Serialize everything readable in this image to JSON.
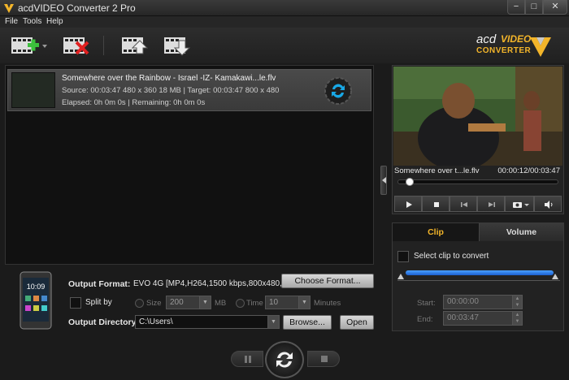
{
  "window": {
    "title": "acdVIDEO Converter 2 Pro",
    "controls": {
      "minimize": "−",
      "maximize": "□",
      "close": "✕"
    }
  },
  "menu": {
    "items": [
      "File",
      "Tools",
      "Help"
    ]
  },
  "toolbar": {
    "buttons": [
      {
        "icon": "add-video-icon"
      },
      {
        "icon": "remove-video-icon"
      },
      {
        "icon": "move-up-icon"
      },
      {
        "icon": "move-down-icon"
      }
    ]
  },
  "logo": {
    "acd": "acd",
    "video": "VIDEO",
    "converter": "CONVERTER"
  },
  "file_list": {
    "items": [
      {
        "name": "Somewhere over the Rainbow - Israel -IZ- Kamakawi...le.flv",
        "info": "Source: 00:03:47 480 x 360 18 MB | Target: 00:03:47 800 x 480",
        "time": "Elapsed: 0h 0m 0s | Remaining: 0h 0m 0s"
      }
    ]
  },
  "output": {
    "format_label": "Output Format:",
    "format_value": "EVO 4G [MP4,H264,1500 kbps,800x480,...",
    "choose_format": "Choose Format...",
    "split_label": "Split by",
    "size_label": "Size",
    "size_value": "200",
    "size_unit": "MB",
    "time_label": "Time",
    "time_value": "10",
    "time_unit": "Minutes",
    "directory_label": "Output Directory:",
    "directory_value": "C:\\Users\\",
    "browse": "Browse...",
    "open": "Open"
  },
  "preview": {
    "file_name": "Somewhere over t...le.flv",
    "time": "00:00:12/00:03:47",
    "seek_fraction": 0.05
  },
  "clip": {
    "tabs": [
      "Clip",
      "Volume"
    ],
    "select_label": "Select clip to convert",
    "start_label": "Start:",
    "start_value": "00:00:00",
    "end_label": "End:",
    "end_value": "00:03:47"
  },
  "colors": {
    "accent": "#f3b52a",
    "convert_icon": "#18a8e6",
    "range": "#2a7fe8"
  }
}
